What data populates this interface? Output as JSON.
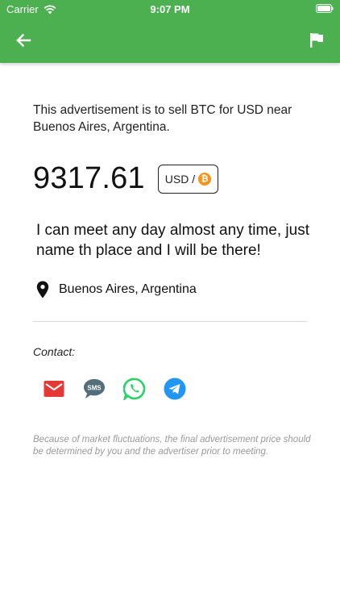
{
  "status_bar": {
    "carrier": "Carrier",
    "time": "9:07 PM"
  },
  "colors": {
    "header": "#4caf50",
    "btc": "#f7931a",
    "email": "#e53935",
    "sms": "#546e7a",
    "whatsapp": "#25d366",
    "telegram": "#2196f3"
  },
  "nav": {
    "back_icon": "arrow-left-icon",
    "report_icon": "flag-icon"
  },
  "ad": {
    "intro": "This advertisement is to sell BTC for USD near Buenos Aires, Argentina.",
    "price": "9317.61",
    "pair_label": "USD /",
    "pair_crypto_symbol": "₿",
    "message": "I can meet any day almost any time, just name th place and I will be there!",
    "location": "Buenos Aires, Argentina"
  },
  "contact": {
    "label": "Contact:",
    "methods": [
      "email",
      "sms",
      "whatsapp",
      "telegram"
    ],
    "sms_text": "SMS"
  },
  "disclaimer": "Because of market fluctuations, the final advertisement price should be determined by you and the advertiser prior to meeting."
}
